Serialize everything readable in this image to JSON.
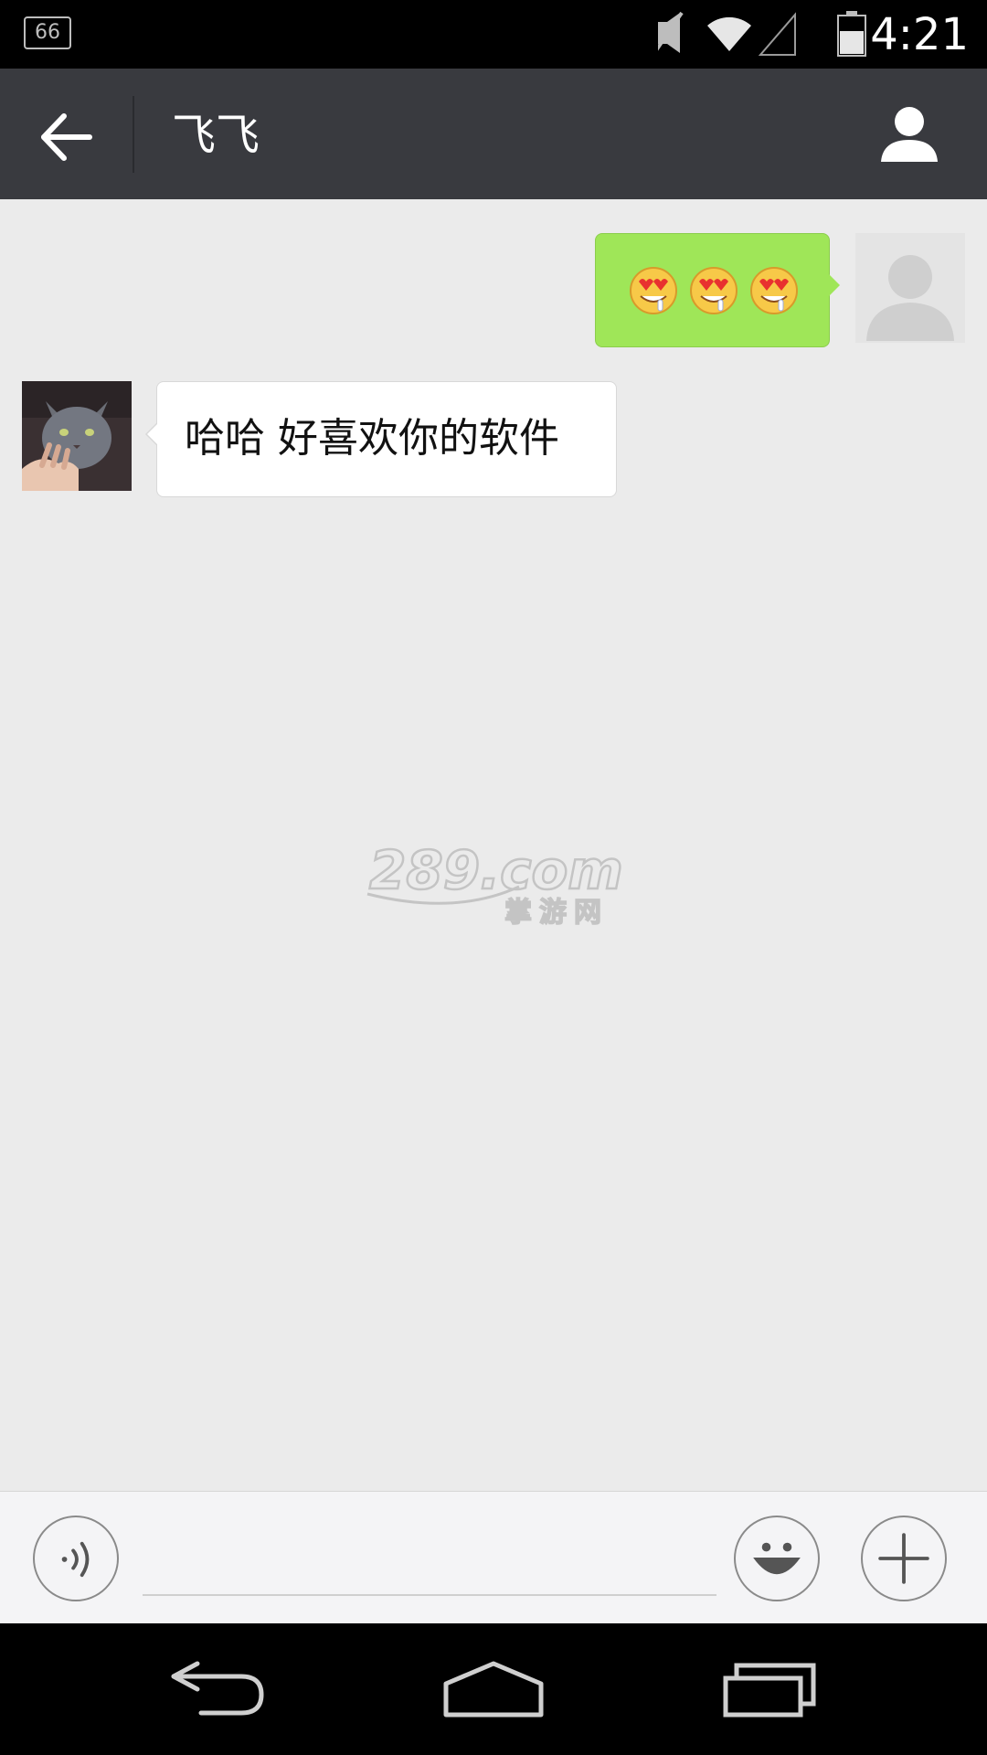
{
  "status_bar": {
    "notification_badge": "66",
    "time": "4:21",
    "icons": [
      "notification-icon",
      "mute-icon",
      "wifi-icon",
      "cell-signal-icon",
      "battery-icon"
    ]
  },
  "title_bar": {
    "title": "飞飞",
    "back_icon": "arrow-left-icon",
    "profile_icon": "person-icon",
    "background": "#393a3f"
  },
  "messages": [
    {
      "sender": "me",
      "emojis": [
        "heart-eyes-drool-emoji",
        "heart-eyes-drool-emoji",
        "heart-eyes-drool-emoji"
      ],
      "bubble_color": "#9fe658"
    },
    {
      "sender": "other",
      "text": "哈哈 好喜欢你的软件",
      "bubble_color": "#ffffff"
    }
  ],
  "watermark": {
    "text": "289.com",
    "subtext": "掌游网"
  },
  "input_bar": {
    "text_value": "",
    "voice_icon": "voice-icon",
    "emoji_icon": "smiley-icon",
    "plus_icon": "plus-icon"
  },
  "nav_bar": {
    "icons": [
      "nav-back-icon",
      "nav-home-icon",
      "nav-recents-icon"
    ]
  }
}
